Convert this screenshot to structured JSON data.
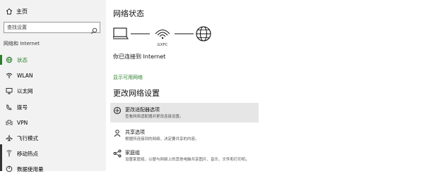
{
  "sidebar": {
    "home_label": "主页",
    "search_placeholder": "查找设置",
    "section_label": "网络和 Internet",
    "items": [
      {
        "label": "状态",
        "icon": "globe-icon",
        "active": true
      },
      {
        "label": "WLAN",
        "icon": "wifi-icon",
        "active": false
      },
      {
        "label": "以太网",
        "icon": "ethernet-icon",
        "active": false
      },
      {
        "label": "拨号",
        "icon": "dialup-icon",
        "active": false
      },
      {
        "label": "VPN",
        "icon": "vpn-icon",
        "active": false
      },
      {
        "label": "飞行模式",
        "icon": "airplane-icon",
        "active": false
      },
      {
        "label": "移动热点",
        "icon": "hotspot-icon",
        "active": false
      },
      {
        "label": "数据使用量",
        "icon": "data-usage-icon",
        "active": false
      }
    ]
  },
  "main": {
    "title": "网络状态",
    "network_name": "GXFC",
    "status_text": "你已连接到 Internet",
    "show_networks_link": "显示可用网络",
    "change_settings_title": "更改网络设置",
    "options": [
      {
        "title": "更改适配器选项",
        "desc": "查看网络适配器并更改连接设置。",
        "icon": "adapter-icon",
        "hover": true
      },
      {
        "title": "共享选项",
        "desc": "根据所连接到的网络，决定要共享的内容。",
        "icon": "sharing-icon",
        "hover": false
      },
      {
        "title": "家庭组",
        "desc": "设置家庭组，以便与网络上的其他电脑共享图片、音乐、文件和打印机。",
        "icon": "homegroup-icon",
        "hover": false
      }
    ]
  },
  "colors": {
    "accent": "#2d7d2d",
    "sidebar_bg": "#f2f2f2",
    "hover_bg": "#e6e6e6"
  }
}
